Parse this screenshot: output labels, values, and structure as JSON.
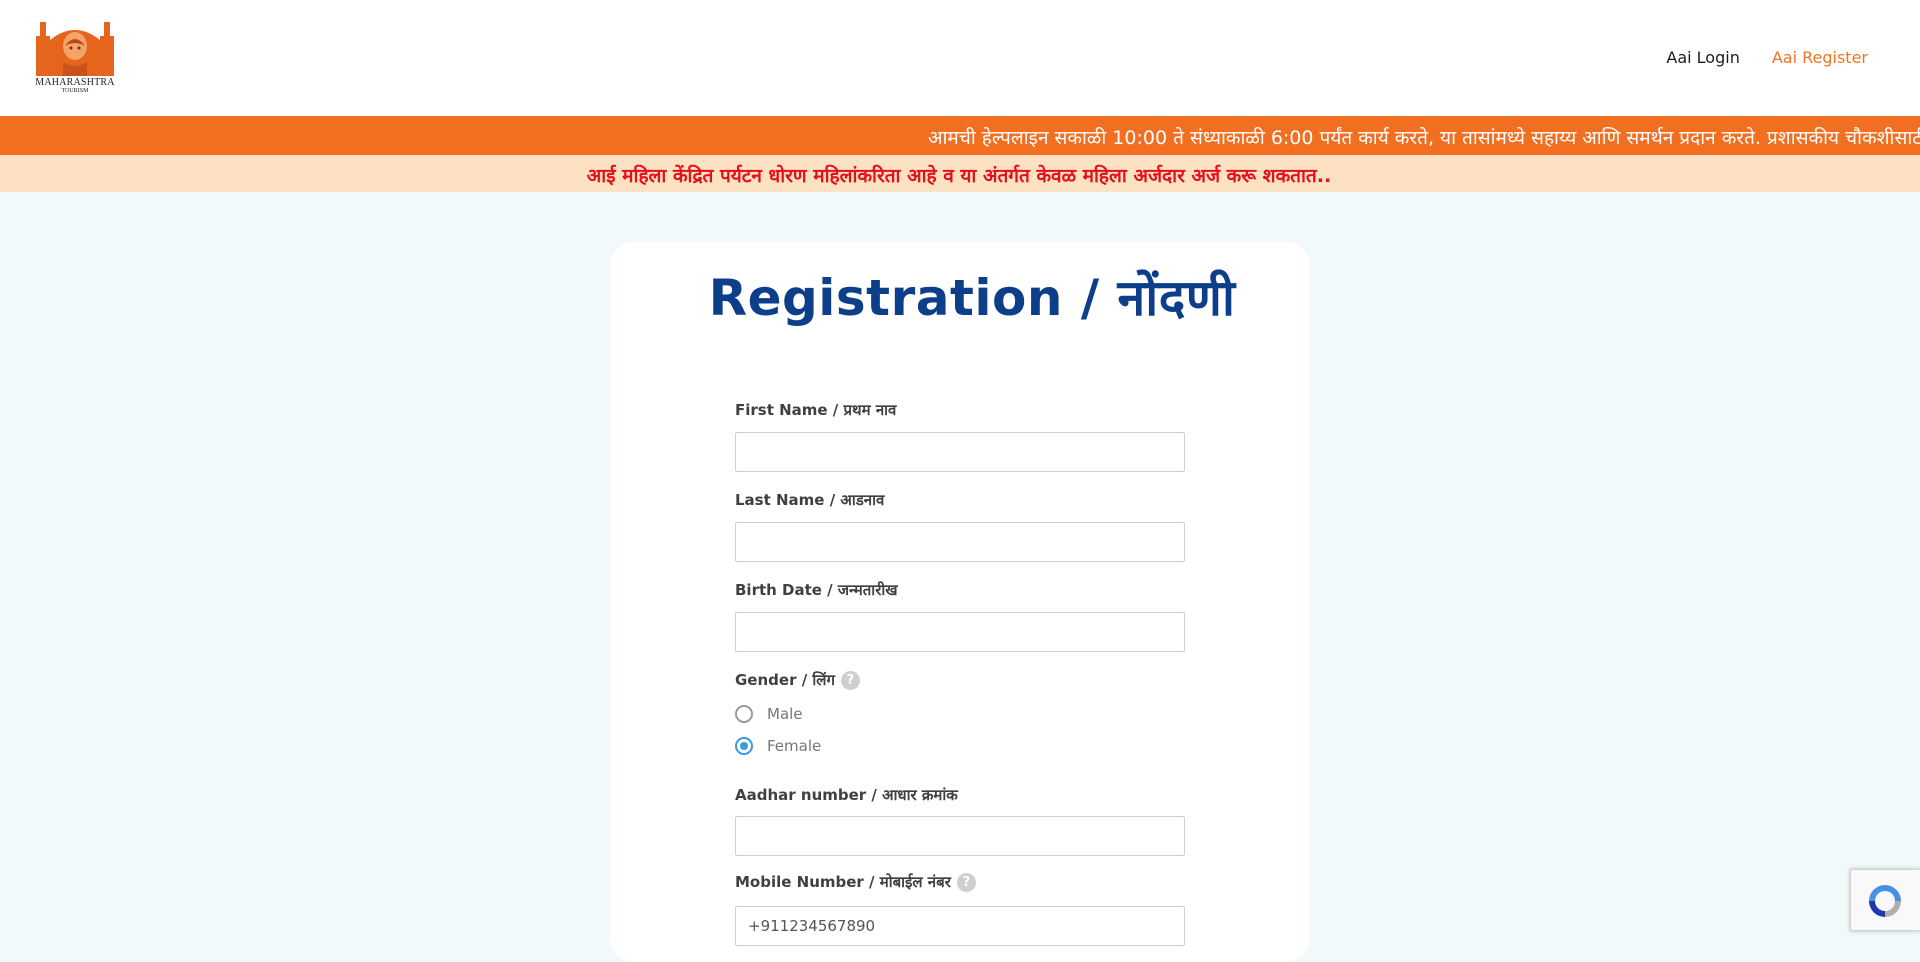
{
  "logo": {
    "name": "MAHARASHTRA",
    "sub": "TOURISM",
    "color": "#e5651d"
  },
  "nav": {
    "login": "Aai Login",
    "register": "Aai Register"
  },
  "marquee": {
    "text": "आमची हेल्पलाइन सकाळी 10:00 ते संध्याकाळी 6:00 पर्यंत कार्य करते, या तासांमध्ये सहाय्य आणि समर्थन प्रदान करते. प्रशासकीय चौकशीसाठी,"
  },
  "notice": {
    "text": "आई महिला केंद्रित पर्यटन धोरण महिलांकरिता आहे व या अंतर्गत केवळ महिला अर्जदार अर्ज करू शकतात.."
  },
  "form": {
    "title": "Registration / नोंदणी",
    "first_name_label": "First Name / प्रथम नाव",
    "first_name_value": "",
    "last_name_label": "Last Name / आडनाव",
    "last_name_value": "",
    "birth_date_label": "Birth Date / जन्मतारीख",
    "birth_date_value": "",
    "gender_label": "Gender / लिंग",
    "gender_help": "?",
    "gender_options": [
      "Male",
      "Female"
    ],
    "gender_selected": "Female",
    "aadhar_label": "Aadhar number / आधार क्रमांक",
    "aadhar_value": "",
    "mobile_label": "Mobile Number / मोबाईल नंबर",
    "mobile_help": "?",
    "mobile_placeholder": "+911234567890"
  },
  "colors": {
    "accent_orange": "#f26e20",
    "title_blue": "#0d3e8a",
    "notice_red": "#e4101b",
    "radio_blue": "#3b9ae0"
  }
}
